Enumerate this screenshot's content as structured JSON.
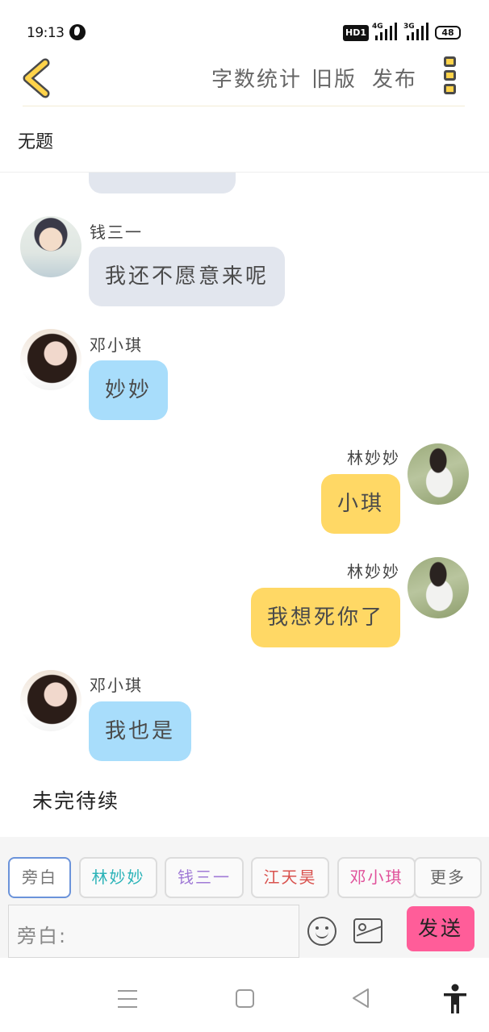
{
  "status_bar": {
    "time": "19:13",
    "hd_label": "HD1",
    "sim1_label": "4G",
    "sim2_label": "3G",
    "battery": "48"
  },
  "header": {
    "back_icon": "chevron-left-icon",
    "word_count": "字数统计",
    "old_version": "旧版",
    "publish": "发布",
    "menu_icon": "vertical-dots-icon"
  },
  "document": {
    "title": "无题"
  },
  "messages": [
    {
      "speaker": "",
      "text": "",
      "side": "left",
      "color": "gray"
    },
    {
      "speaker": "钱三一",
      "text": "我还不愿意来呢",
      "side": "left",
      "color": "gray"
    },
    {
      "speaker": "邓小琪",
      "text": "妙妙",
      "side": "left",
      "color": "blue"
    },
    {
      "speaker": "林妙妙",
      "text": "小琪",
      "side": "right",
      "color": "yellow"
    },
    {
      "speaker": "林妙妙",
      "text": "我想死你了",
      "side": "right",
      "color": "yellow"
    },
    {
      "speaker": "邓小琪",
      "text": "我也是",
      "side": "left",
      "color": "blue"
    }
  ],
  "continuation": "未完待续",
  "role_chips": [
    {
      "label": "旁白",
      "color": "#777777",
      "active": true
    },
    {
      "label": "林妙妙",
      "color": "#2bb3b8",
      "active": false
    },
    {
      "label": "钱三一",
      "color": "#a07ad6",
      "active": false
    },
    {
      "label": "江天昊",
      "color": "#d9534f",
      "active": false
    },
    {
      "label": "邓小琪",
      "color": "#e0509a",
      "active": false
    },
    {
      "label": "更多",
      "color": "#666666",
      "active": false
    }
  ],
  "composer": {
    "placeholder": "旁白:",
    "emoji_icon": "smiley-icon",
    "image_icon": "image-icon",
    "send_label": "发送",
    "send_color": "#ff5d99"
  },
  "nav_bar": {
    "icons": [
      "menu-icon",
      "home-icon",
      "back-icon",
      "accessibility-icon"
    ]
  },
  "colors": {
    "accent_yellow": "#ffd34a",
    "bubble_gray": "#e2e6ee",
    "bubble_blue": "#a8ddfb",
    "bubble_yellow": "#ffd865"
  }
}
